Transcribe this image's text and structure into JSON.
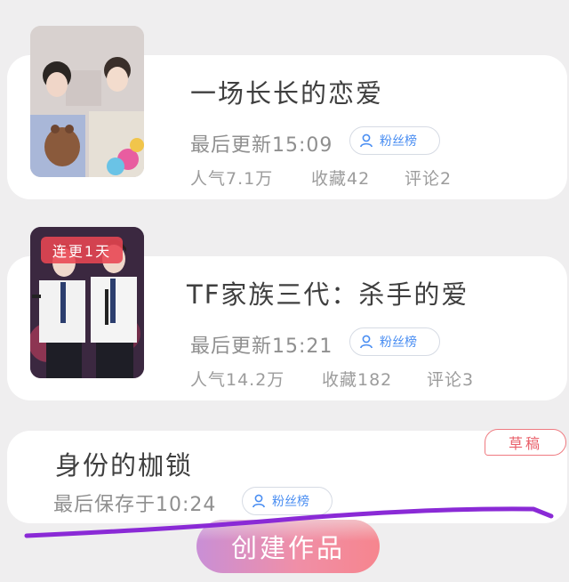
{
  "works": [
    {
      "title": "一场长长的恋爱",
      "last_update": "最后更新15:09",
      "fan_list_label": "粉丝榜",
      "popularity": "人气7.1万",
      "favorites": "收藏42",
      "comments": "评论2"
    },
    {
      "title": "TF家族三代：杀手的爱",
      "badge": "连更1天",
      "last_update": "最后更新15:21",
      "fan_list_label": "粉丝榜",
      "popularity": "人气14.2万",
      "favorites": "收藏182",
      "comments": "评论3"
    }
  ],
  "draft": {
    "tag": "草稿",
    "title": "身份的枷锁",
    "last_saved": "最后保存于10:24",
    "fan_list_label": "粉丝榜"
  },
  "create_button": "创建作品",
  "colors": {
    "accent_blue": "#4a8ef2",
    "badge_red": "#e84652",
    "draft_red": "#e9606a",
    "button_gradient_start": "#c98fd6",
    "button_gradient_end": "#f6858e",
    "scribble_purple": "#8a2ad6"
  },
  "icons": {
    "fan_list": "person-icon"
  }
}
